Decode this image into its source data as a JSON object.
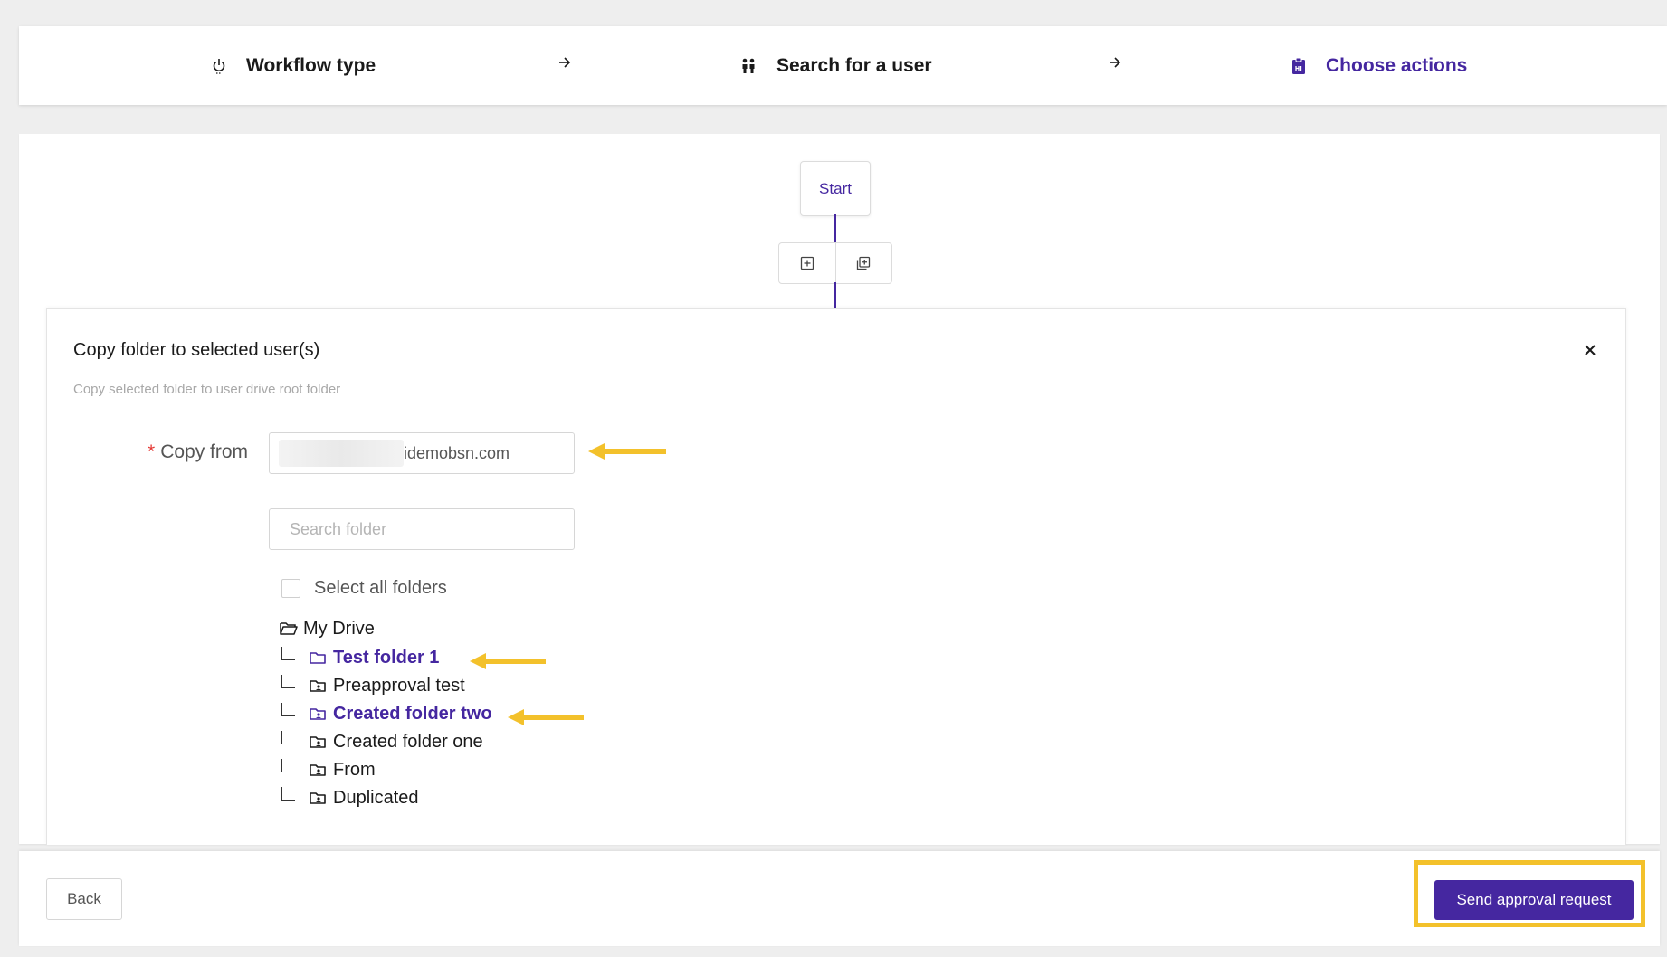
{
  "stepper": {
    "steps": [
      {
        "label": "Workflow type",
        "icon": "power-icon",
        "active": false
      },
      {
        "label": "Search for a user",
        "icon": "users-icon",
        "active": false
      },
      {
        "label": "Choose actions",
        "icon": "clipboard-icon",
        "active": true
      }
    ],
    "arrow_icon": "arrow-right-icon"
  },
  "flow": {
    "start_label": "Start",
    "toolbar_icons": [
      "add-node-icon",
      "add-multiple-icon"
    ]
  },
  "dialog": {
    "title": "Copy folder to selected user(s)",
    "description": "Copy selected folder to user drive root folder",
    "copy_from": {
      "label": "Copy from",
      "required": true,
      "value": "idemobsn.com"
    },
    "search": {
      "placeholder": "Search folder",
      "value": ""
    },
    "select_all_label": "Select all folders",
    "tree": {
      "root": "My Drive",
      "children": [
        {
          "name": "Test folder 1",
          "selected": true,
          "icon": "folder-icon"
        },
        {
          "name": "Preapproval test",
          "selected": false,
          "icon": "shared-folder-icon"
        },
        {
          "name": "Created folder two",
          "selected": true,
          "icon": "shared-folder-icon"
        },
        {
          "name": "Created folder one",
          "selected": false,
          "icon": "shared-folder-icon"
        },
        {
          "name": "From",
          "selected": false,
          "icon": "shared-folder-icon"
        },
        {
          "name": "Duplicated",
          "selected": false,
          "icon": "shared-folder-icon"
        }
      ]
    }
  },
  "footer": {
    "back_label": "Back",
    "send_label": "Send approval request"
  },
  "colors": {
    "accent": "#4527a0",
    "annotation": "#f3c12b",
    "required": "#e53935"
  }
}
